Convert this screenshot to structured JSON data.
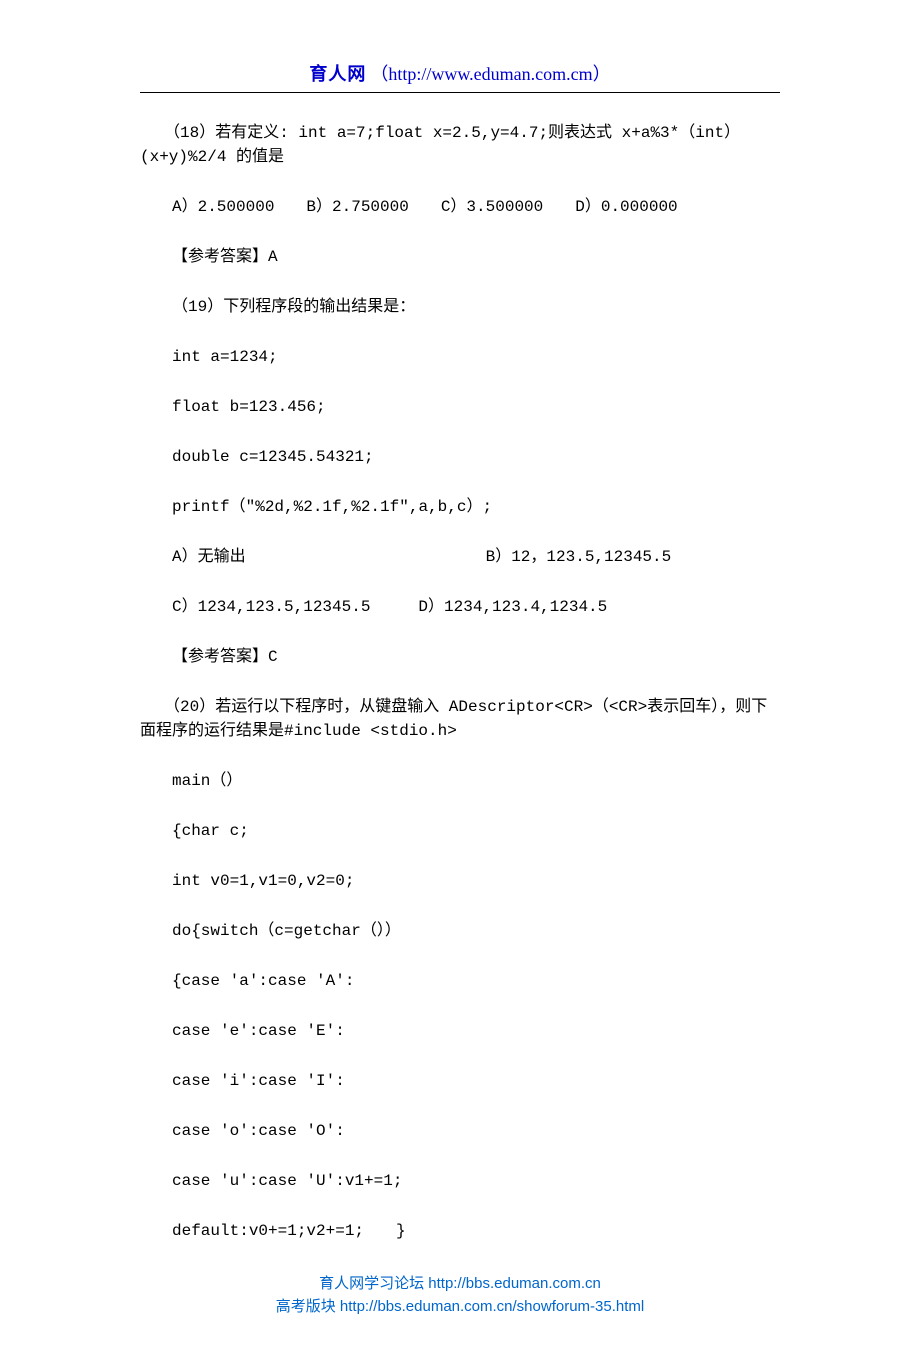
{
  "header": {
    "site": "育人网",
    "url": "（http://www.eduman.com.cm）"
  },
  "paragraphs": {
    "p1": "　　（18）若有定义: int a=7;float x=2.5,y=4.7;则表达式 x+a%3*（int）(x+y)%2/4 的值是",
    "p2": "A）2.500000　　B）2.750000　　C）3.500000　　D）0.000000",
    "p3": "【参考答案】A",
    "p4": "（19）下列程序段的输出结果是：",
    "p5": "int a=1234;",
    "p6": "float b=123.456;",
    "p7": "double c=12345.54321;",
    "p8": "printf（\"%2d,%2.1f,%2.1f\",a,b,c）;",
    "p9": "A）无输出　　　　　　　　　　　　　　　B）12，123.5,12345.5",
    "p10": "C）1234,123.5,12345.5　　　D）1234,123.4,1234.5",
    "p11": "【参考答案】C",
    "p12": "　　（20）若运行以下程序时，从键盘输入 ADescriptor<CR>（<CR>表示回车），则下面程序的运行结果是#include <stdio.h>",
    "p13": "main（）",
    "p14": "{char c;",
    "p15": "int v0=1,v1=0,v2=0;",
    "p16": "do{switch（c=getchar（））",
    "p17": "{case ′a′:case ′A′:",
    "p18": "case ′e′:case ′E′:",
    "p19": "case ′i′:case ′I′:",
    "p20": "case ′o′:case ′O′:",
    "p21": "case ′u′:case ′U′:v1+=1;",
    "p22": "default:v0+=1;v2+=1;　　}"
  },
  "footer": {
    "line1": "育人网学习论坛  http://bbs.eduman.com.cn",
    "line2": "高考版块  http://bbs.eduman.com.cn/showforum-35.html"
  }
}
